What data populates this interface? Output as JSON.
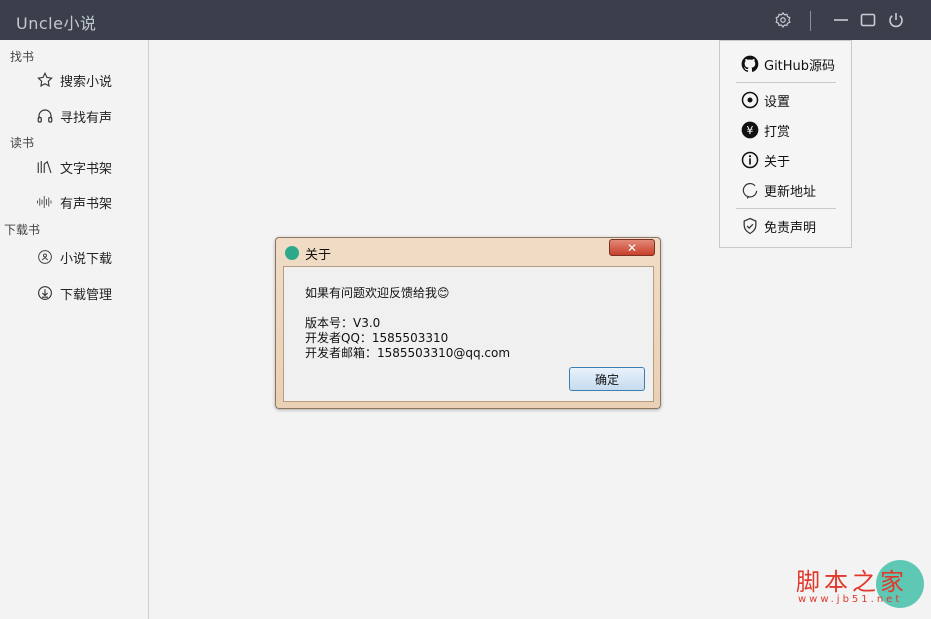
{
  "app": {
    "title": "Uncle小说"
  },
  "sidebar": {
    "groups": [
      {
        "label": "找书",
        "items": [
          {
            "label": "搜索小说",
            "icon": "star-icon"
          },
          {
            "label": "寻找有声",
            "icon": "headphones-icon"
          }
        ]
      },
      {
        "label": "读书",
        "items": [
          {
            "label": "文字书架",
            "icon": "books-icon"
          },
          {
            "label": "有声书架",
            "icon": "audio-wave-icon"
          }
        ]
      },
      {
        "label": "下载书",
        "items": [
          {
            "label": "小说下载",
            "icon": "download-badge-icon"
          },
          {
            "label": "下载管理",
            "icon": "cloud-download-icon"
          }
        ]
      }
    ]
  },
  "menu": {
    "items": [
      {
        "label": "GitHub源码",
        "icon": "github-icon"
      },
      {
        "label": "设置",
        "icon": "target-icon"
      },
      {
        "label": "打赏",
        "icon": "yen-icon"
      },
      {
        "label": "关于",
        "icon": "info-icon"
      },
      {
        "label": "更新地址",
        "icon": "refresh-icon"
      },
      {
        "label": "免责声明",
        "icon": "shield-icon"
      }
    ]
  },
  "dialog": {
    "title": "关于",
    "close_label": "✕",
    "message": "如果有问题欢迎反馈给我😊",
    "version": "版本号：V3.0",
    "qq": "开发者QQ：1585503310",
    "email": "开发者邮箱：1585503310@qq.com",
    "ok_label": "确定"
  },
  "watermark": {
    "title": "脚本之家",
    "url": "www.jb51.net"
  },
  "colors": {
    "titlebar": "#3a3f4b",
    "accent": "#2ea88a",
    "watermark": "#e0392b"
  }
}
